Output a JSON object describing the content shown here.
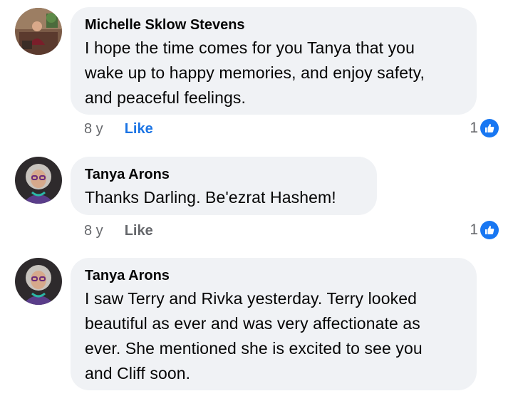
{
  "comments": [
    {
      "author": "Michelle Sklow Stevens",
      "text": "I hope the time comes for you Tanya that you\nwake up to happy memories, and enjoy safety,\nand peaceful feelings.",
      "time": "8 y",
      "like_label": "Like",
      "reaction_count": "1",
      "liked": true
    },
    {
      "author": "Tanya Arons",
      "text": "Thanks Darling. Be'ezrat Hashem!",
      "time": "8 y",
      "like_label": "Like",
      "reaction_count": "1",
      "liked": false
    },
    {
      "author": "Tanya Arons",
      "text": "I saw Terry and Rivka yesterday.  Terry looked\nbeautiful as ever and was very affectionate as\never.  She mentioned she is excited to see you\nand Cliff soon.",
      "time": "",
      "like_label": "",
      "reaction_count": "",
      "liked": false
    }
  ],
  "colors": {
    "bubble": "#f0f2f5",
    "like_active": "#1b74e4",
    "reaction_badge": "#1877f2",
    "meta_text": "#65676b"
  },
  "icons": {
    "reaction": "thumbs-up-icon"
  }
}
